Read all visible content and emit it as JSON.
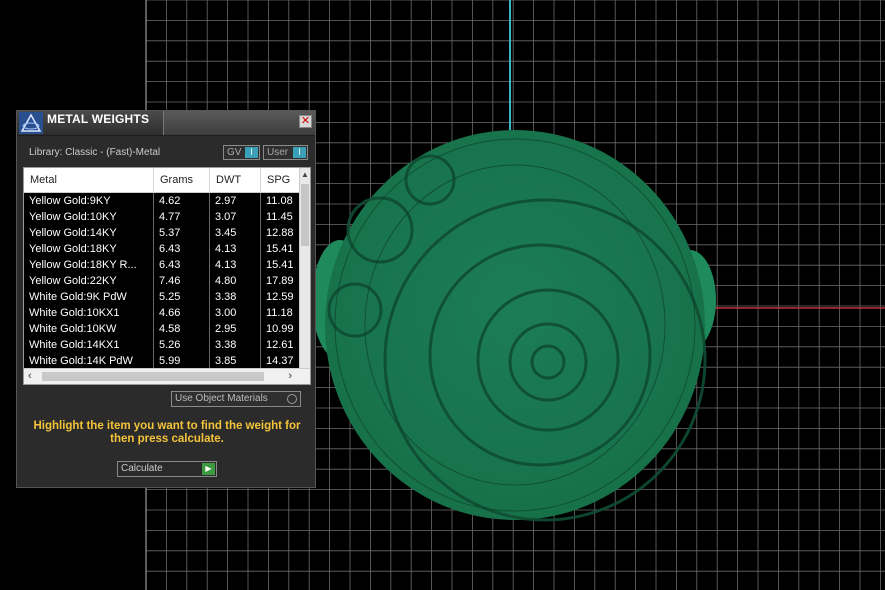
{
  "panel": {
    "title": "METAL WEIGHTS",
    "close_glyph": "✕",
    "library_label": "Library: Classic - (Fast)-Metal",
    "toggles": [
      {
        "label": "GV",
        "state": "I"
      },
      {
        "label": "User",
        "state": "I"
      }
    ],
    "table": {
      "columns": [
        "Metal",
        "Grams",
        "DWT",
        "SPG"
      ],
      "rows": [
        [
          "Yellow Gold:9KY",
          "4.62",
          "2.97",
          "11.08"
        ],
        [
          "Yellow Gold:10KY",
          "4.77",
          "3.07",
          "11.45"
        ],
        [
          "Yellow Gold:14KY",
          "5.37",
          "3.45",
          "12.88"
        ],
        [
          "Yellow Gold:18KY",
          "6.43",
          "4.13",
          "15.41"
        ],
        [
          "Yellow Gold:18KY R...",
          "6.43",
          "4.13",
          "15.41"
        ],
        [
          "Yellow Gold:22KY",
          "7.46",
          "4.80",
          "17.89"
        ],
        [
          "White Gold:9K PdW",
          "5.25",
          "3.38",
          "12.59"
        ],
        [
          "White Gold:10KX1",
          "4.66",
          "3.00",
          "11.18"
        ],
        [
          "White Gold:10KW",
          "4.58",
          "2.95",
          "10.99"
        ],
        [
          "White Gold:14KX1",
          "5.26",
          "3.38",
          "12.61"
        ],
        [
          "White Gold:14K PdW",
          "5.99",
          "3.85",
          "14.37"
        ]
      ]
    },
    "use_object_materials_label": "Use Object Materials",
    "instructions": "Highlight the item you want to find the weight for then press calculate.",
    "calculate_label": "Calculate",
    "colors": {
      "panel_bg": "#2b2b2b",
      "instruction_text": "#f3c43a",
      "toggle_accent": "#3aa0b8",
      "calculate_accent": "#3e9a3e"
    }
  },
  "viewport": {
    "model_color": "#1f8a5c",
    "axis_vertical_color": "#3fb6c8",
    "axis_horizontal_color": "#c0303a",
    "grid_color": "#6a6a6a"
  }
}
